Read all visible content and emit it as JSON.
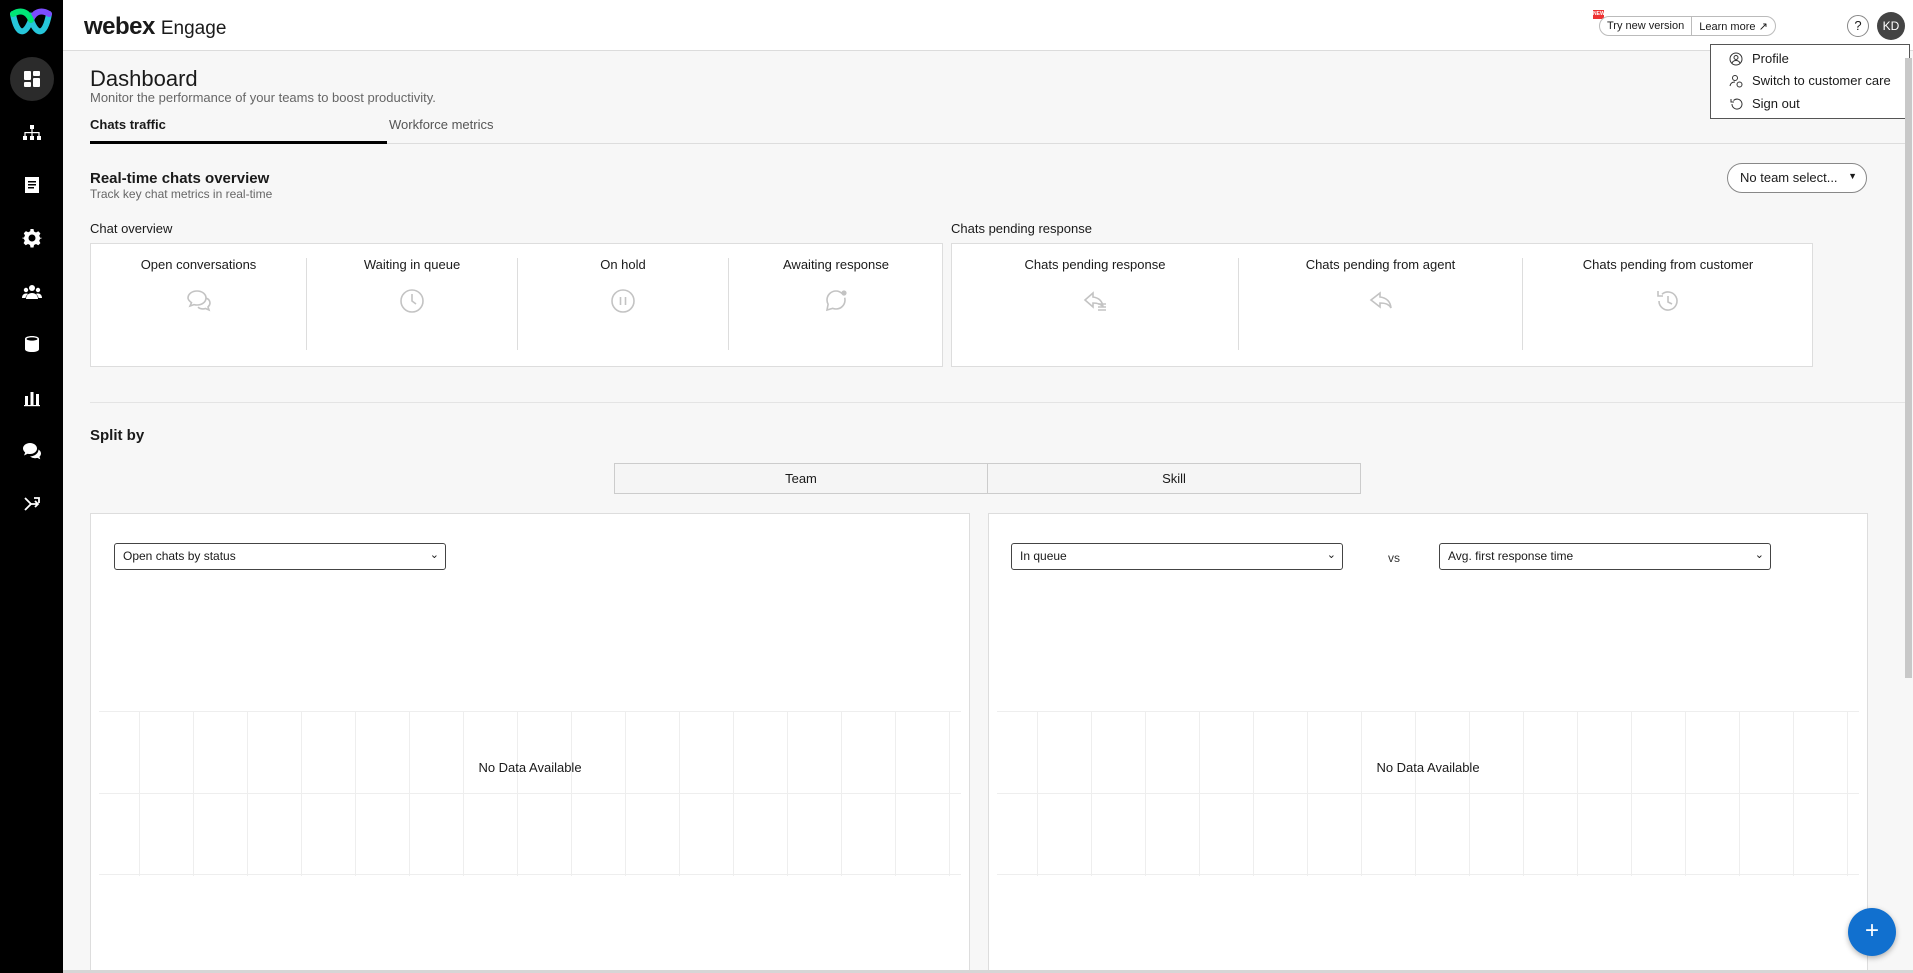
{
  "app": {
    "brand": "webex",
    "product": "Engage"
  },
  "sidebar": {
    "items": [
      {
        "icon": "dashboard-icon",
        "active": true
      },
      {
        "icon": "org-chart-icon"
      },
      {
        "icon": "document-icon"
      },
      {
        "icon": "gear-icon"
      },
      {
        "icon": "team-icon"
      },
      {
        "icon": "database-icon"
      },
      {
        "icon": "bar-chart-icon"
      },
      {
        "icon": "chat-icon"
      },
      {
        "icon": "routing-icon"
      }
    ]
  },
  "topbar": {
    "badge": "NEW",
    "try_new_version": "Try new version",
    "learn_more": "Learn more",
    "help": "?",
    "avatar_initials": "KD"
  },
  "user_menu": {
    "items": [
      {
        "label": "Profile",
        "icon": "profile-icon"
      },
      {
        "label": "Switch to customer care",
        "icon": "switch-user-icon"
      },
      {
        "label": "Sign out",
        "icon": "sign-out-icon"
      }
    ]
  },
  "page": {
    "title": "Dashboard",
    "subtitle": "Monitor the performance of your teams to boost productivity.",
    "tabs": [
      {
        "label": "Chats traffic"
      },
      {
        "label": "Workforce metrics"
      }
    ]
  },
  "realtime": {
    "title": "Real-time chats overview",
    "subtitle": "Track key chat metrics in real-time",
    "team_select": "No team select...",
    "chat_overview_label": "Chat overview",
    "chat_overview": [
      {
        "label": "Open conversations",
        "icon": "conversation-icon"
      },
      {
        "label": "Waiting in queue",
        "icon": "clock-icon"
      },
      {
        "label": "On hold",
        "icon": "pause-icon"
      },
      {
        "label": "Awaiting response",
        "icon": "chat-bubble-icon"
      }
    ],
    "pending_label": "Chats pending response",
    "pending": [
      {
        "label": "Chats pending response",
        "icon": "reply-list-icon"
      },
      {
        "label": "Chats pending from agent",
        "icon": "reply-icon"
      },
      {
        "label": "Chats pending from customer",
        "icon": "history-icon"
      }
    ]
  },
  "split": {
    "title": "Split by",
    "options": [
      "Team",
      "Skill"
    ],
    "left_panel": {
      "select": "Open chats by status",
      "no_data": "No Data Available"
    },
    "right_panel": {
      "select_a": "In queue",
      "vs": "vs",
      "select_b": "Avg. first response time",
      "no_data": "No Data Available"
    }
  },
  "fab_label": "+",
  "colors": {
    "sidebar": "#000000",
    "accent": "#1170cf",
    "badge": "#ee3333"
  }
}
